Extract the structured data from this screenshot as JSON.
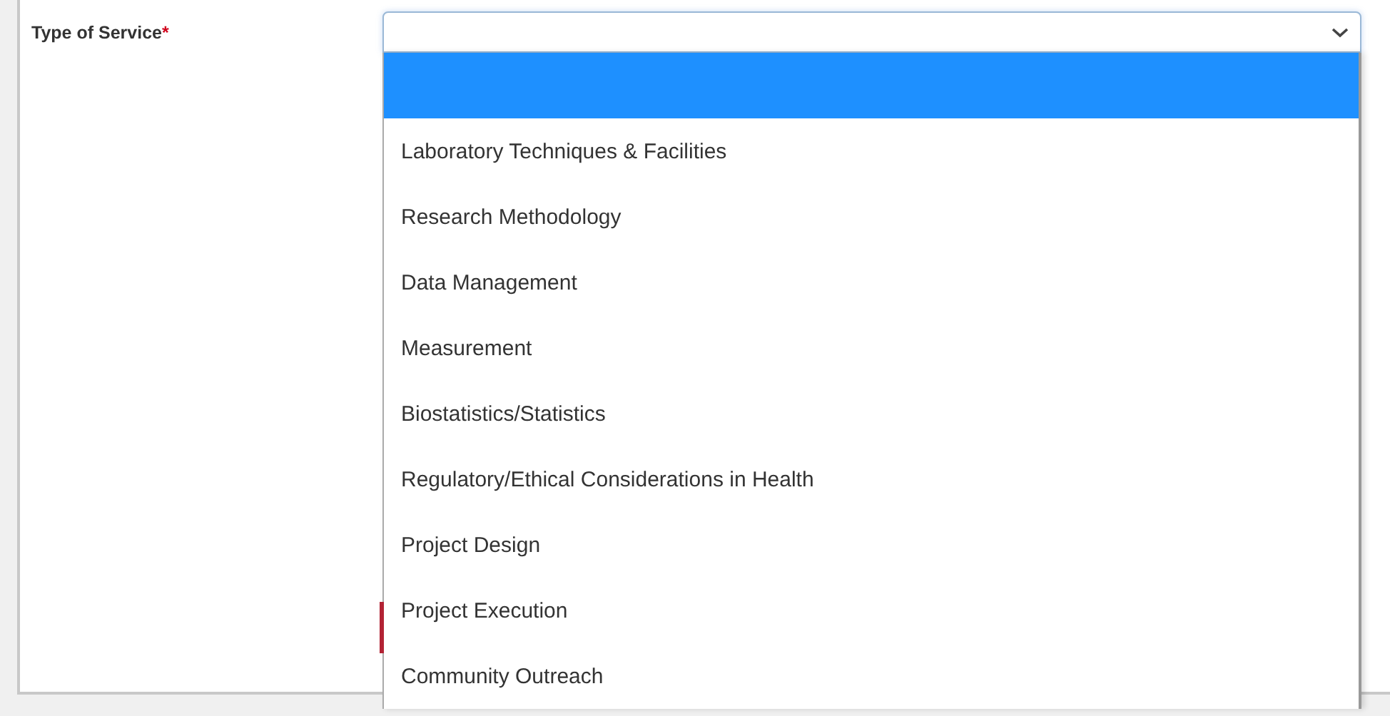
{
  "field": {
    "label": "Type of Service",
    "required_mark": "*",
    "expanded": true
  },
  "options": [
    {
      "selected": true
    },
    {
      "label": "Laboratory Techniques & Facilities",
      "selected": false
    },
    {
      "label": "Research Methodology",
      "selected": false
    },
    {
      "label": "Data Management",
      "selected": false
    },
    {
      "label": "Measurement",
      "selected": false
    },
    {
      "label": "Biostatistics/Statistics",
      "selected": false
    },
    {
      "label": "Regulatory/Ethical Considerations in Health",
      "selected": false
    },
    {
      "label": "Project Design",
      "selected": false
    },
    {
      "label": "Project Execution",
      "selected": false
    },
    {
      "label": "Community Outreach",
      "selected": false
    }
  ]
}
